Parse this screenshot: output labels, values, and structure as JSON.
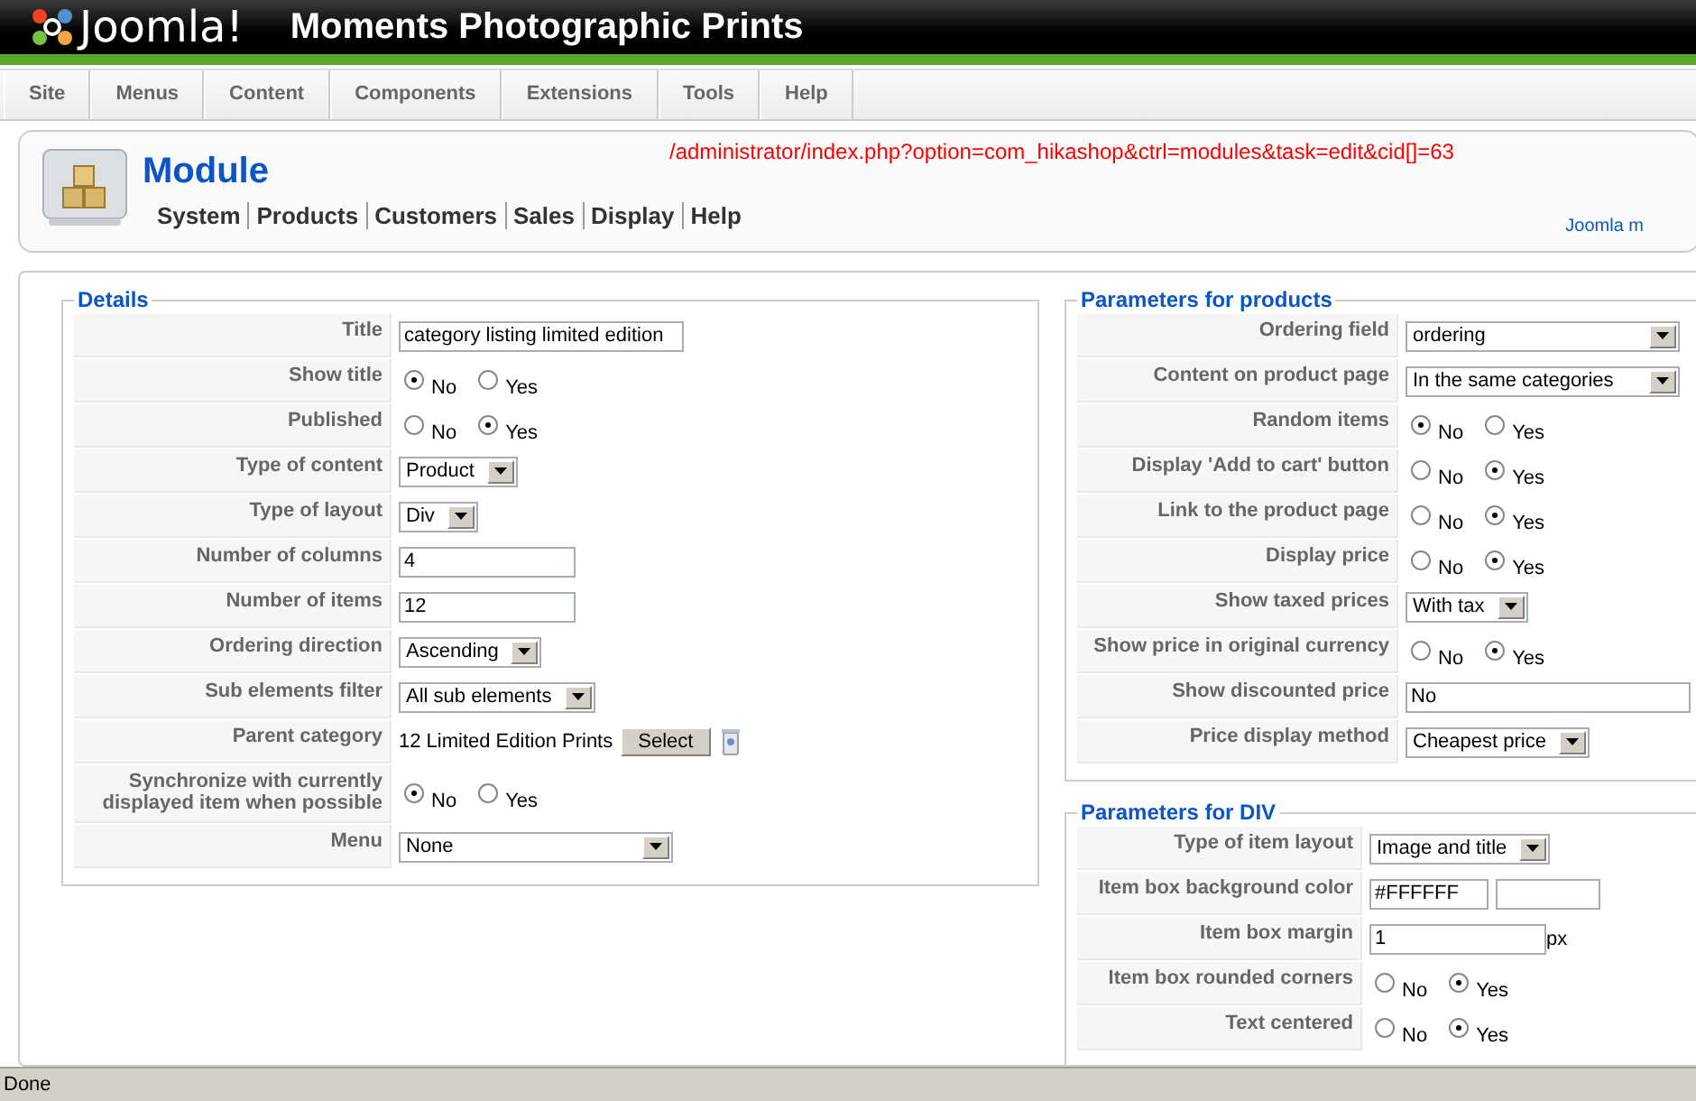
{
  "header": {
    "logo": "Joomla!",
    "site_title": "Moments Photographic Prints"
  },
  "menu": [
    "Site",
    "Menus",
    "Content",
    "Components",
    "Extensions",
    "Tools",
    "Help"
  ],
  "toolbar": {
    "title": "Module",
    "url": "/administrator/index.php?option=com_hikashop&ctrl=modules&task=edit&cid[]=63",
    "links": [
      "System",
      "Products",
      "Customers",
      "Sales",
      "Display",
      "Help"
    ],
    "side_link": "Joomla m"
  },
  "details": {
    "legend": "Details",
    "rows": [
      {
        "label": "Title",
        "kind": "text",
        "value": "category listing limited edition"
      },
      {
        "label": "Show title",
        "kind": "radio",
        "options": [
          {
            "label": "No",
            "selected": true
          },
          {
            "label": "Yes",
            "selected": false
          }
        ]
      },
      {
        "label": "Published",
        "kind": "radio",
        "options": [
          {
            "label": "No",
            "selected": false
          },
          {
            "label": "Yes",
            "selected": true
          }
        ]
      },
      {
        "label": "Type of content",
        "kind": "select",
        "value": "Product"
      },
      {
        "label": "Type of layout",
        "kind": "select",
        "value": "Div"
      },
      {
        "label": "Number of columns",
        "kind": "number",
        "value": "4"
      },
      {
        "label": "Number of items",
        "kind": "number",
        "value": "12"
      },
      {
        "label": "Ordering direction",
        "kind": "select",
        "value": "Ascending"
      },
      {
        "label": "Sub elements filter",
        "kind": "select",
        "value": "All sub elements"
      },
      {
        "label": "Parent category",
        "kind": "category",
        "value": "12 Limited Edition Prints",
        "button": "Select"
      },
      {
        "label": "Synchronize with currently displayed item when possible",
        "kind": "radio",
        "options": [
          {
            "label": "No",
            "selected": true
          },
          {
            "label": "Yes",
            "selected": false
          }
        ]
      },
      {
        "label": "Menu",
        "kind": "long_select",
        "value": "None"
      }
    ]
  },
  "product_params": {
    "legend": "Parameters for products",
    "rows": [
      {
        "label": "Ordering field",
        "kind": "long_select",
        "value": "ordering"
      },
      {
        "label": "Content on product page",
        "kind": "long_select",
        "value": "In the same categories"
      },
      {
        "label": "Random items",
        "kind": "radio",
        "options": [
          {
            "label": "No",
            "selected": true
          },
          {
            "label": "Yes",
            "selected": false
          }
        ]
      },
      {
        "label": "Display 'Add to cart' button",
        "kind": "radio",
        "options": [
          {
            "label": "No",
            "selected": false
          },
          {
            "label": "Yes",
            "selected": true
          }
        ]
      },
      {
        "label": "Link to the product page",
        "kind": "radio",
        "options": [
          {
            "label": "No",
            "selected": false
          },
          {
            "label": "Yes",
            "selected": true
          }
        ]
      },
      {
        "label": "Display price",
        "kind": "radio",
        "options": [
          {
            "label": "No",
            "selected": false
          },
          {
            "label": "Yes",
            "selected": true
          }
        ]
      },
      {
        "label": "Show taxed prices",
        "kind": "select",
        "value": "With tax"
      },
      {
        "label": "Show price in original currency",
        "kind": "radio",
        "options": [
          {
            "label": "No",
            "selected": false
          },
          {
            "label": "Yes",
            "selected": true
          }
        ]
      },
      {
        "label": "Show discounted price",
        "kind": "text",
        "value": "No"
      },
      {
        "label": "Price display method",
        "kind": "select",
        "value": "Cheapest price"
      }
    ]
  },
  "div_params": {
    "legend": "Parameters for DIV",
    "rows": [
      {
        "label": "Type of item layout",
        "kind": "select",
        "value": "Image and title"
      },
      {
        "label": "Item box background color",
        "kind": "color",
        "value": "#FFFFFF"
      },
      {
        "label": "Item box margin",
        "kind": "margin",
        "value": "1",
        "unit": "px"
      },
      {
        "label": "Item box rounded corners",
        "kind": "radio",
        "options": [
          {
            "label": "No",
            "selected": false
          },
          {
            "label": "Yes",
            "selected": true
          }
        ]
      },
      {
        "label": "Text centered",
        "kind": "radio",
        "options": [
          {
            "label": "No",
            "selected": false
          },
          {
            "label": "Yes",
            "selected": true
          }
        ]
      }
    ]
  },
  "status_bar": "Done"
}
